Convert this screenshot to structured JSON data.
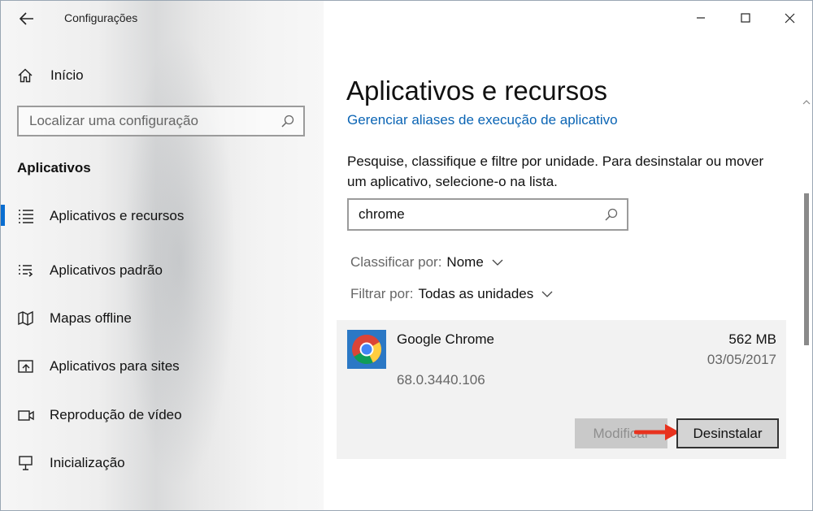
{
  "window": {
    "title": "Configurações",
    "controls": {
      "minimize": "–",
      "maximize": "☐",
      "close": "✕"
    }
  },
  "sidebar": {
    "back_icon": "back-arrow-icon",
    "home_label": "Início",
    "search_placeholder": "Localizar uma configuração",
    "section_title": "Aplicativos",
    "items": [
      {
        "label": "Aplicativos e recursos",
        "icon": "apps-features-icon",
        "active": true
      },
      {
        "label": "Aplicativos padrão",
        "icon": "default-apps-icon",
        "active": false
      },
      {
        "label": "Mapas offline",
        "icon": "offline-maps-icon",
        "active": false
      },
      {
        "label": "Aplicativos para sites",
        "icon": "apps-for-websites-icon",
        "active": false
      },
      {
        "label": "Reprodução de vídeo",
        "icon": "video-playback-icon",
        "active": false
      },
      {
        "label": "Inicialização",
        "icon": "startup-icon",
        "active": false
      }
    ]
  },
  "main": {
    "title": "Aplicativos e recursos",
    "alias_link": "Gerenciar aliases de execução de aplicativo",
    "description": "Pesquise, classifique e filtre por unidade. Para desinstalar ou mover um aplicativo, selecione-o na lista.",
    "search_value": "chrome",
    "sort_key": "Classificar por:",
    "sort_value": "Nome",
    "filter_key": "Filtrar por:",
    "filter_value": "Todas as unidades",
    "app": {
      "name": "Google Chrome",
      "version": "68.0.3440.106",
      "size": "562 MB",
      "date": "03/05/2017",
      "icon": "chrome-icon",
      "modify_label": "Modificar",
      "uninstall_label": "Desinstalar"
    }
  },
  "colors": {
    "accent": "#0a6ed1",
    "link": "#0a64b4",
    "arrow": "#e8321e",
    "card_bg": "#f2f2f2"
  }
}
